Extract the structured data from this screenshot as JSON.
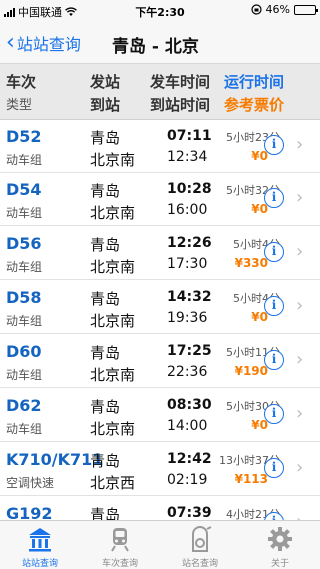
{
  "status_bar": {
    "carrier": "中国联通",
    "time": "下午2:30",
    "battery": "46%",
    "battery_level": 0.46
  },
  "nav": {
    "back_label": "站站查询",
    "title": "青岛 - 北京"
  },
  "columns": {
    "train": "车次",
    "type": "类型",
    "from": "发站",
    "to": "到站",
    "depart": "发车时间",
    "arrive": "到站时间",
    "duration": "运行时间",
    "price": "参考票价"
  },
  "trains": [
    {
      "no": "D52",
      "type": "动车组",
      "from": "青岛",
      "to": "北京南",
      "depart": "07:11",
      "arrive": "12:34",
      "duration": "5小时23分",
      "price": "¥0"
    },
    {
      "no": "D54",
      "type": "动车组",
      "from": "青岛",
      "to": "北京南",
      "depart": "10:28",
      "arrive": "16:00",
      "duration": "5小时32分",
      "price": "¥0"
    },
    {
      "no": "D56",
      "type": "动车组",
      "from": "青岛",
      "to": "北京南",
      "depart": "12:26",
      "arrive": "17:30",
      "duration": "5小时4分",
      "price": "¥330"
    },
    {
      "no": "D58",
      "type": "动车组",
      "from": "青岛",
      "to": "北京南",
      "depart": "14:32",
      "arrive": "19:36",
      "duration": "5小时4分",
      "price": "¥0"
    },
    {
      "no": "D60",
      "type": "动车组",
      "from": "青岛",
      "to": "北京南",
      "depart": "17:25",
      "arrive": "22:36",
      "duration": "5小时11分",
      "price": "¥190"
    },
    {
      "no": "D62",
      "type": "动车组",
      "from": "青岛",
      "to": "北京南",
      "depart": "08:30",
      "arrive": "14:00",
      "duration": "5小时30分",
      "price": "¥0"
    },
    {
      "no": "K710/K711",
      "type": "空调快速",
      "from": "青岛",
      "to": "北京西",
      "depart": "12:42",
      "arrive": "02:19",
      "duration": "13小时37分",
      "price": "¥113"
    },
    {
      "no": "G192",
      "type": "",
      "from": "青岛",
      "to": "",
      "depart": "07:39",
      "arrive": "",
      "duration": "4小时21分",
      "price": ""
    }
  ],
  "tabs": [
    {
      "label": "站站查询",
      "icon": "station-building-icon",
      "active": true
    },
    {
      "label": "车次查询",
      "icon": "train-icon",
      "active": false
    },
    {
      "label": "站名查询",
      "icon": "station-name-icon",
      "active": false
    },
    {
      "label": "关于",
      "icon": "gear-icon",
      "active": false
    }
  ],
  "colors": {
    "accent": "#1a73e8",
    "price": "#f57c00",
    "train_no": "#1565c0"
  }
}
